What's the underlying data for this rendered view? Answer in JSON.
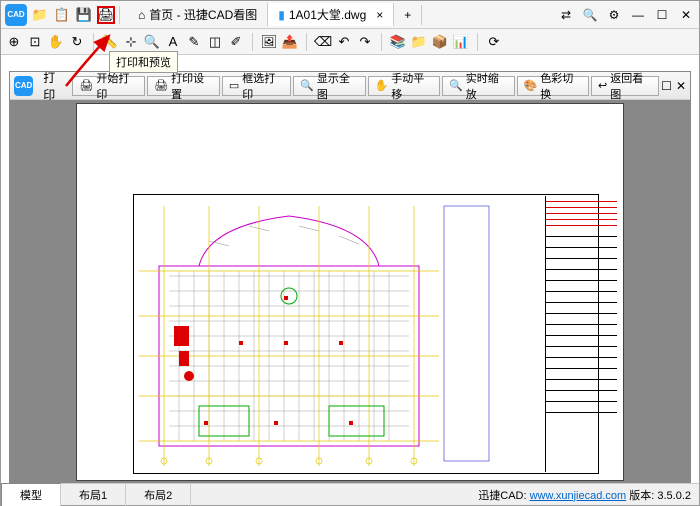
{
  "app": {
    "logo_text": "CAD"
  },
  "tabs": {
    "home": "首页 - 迅捷CAD看图",
    "file": "1A01大堂.dwg",
    "add": "+"
  },
  "tooltip": "打印和预览",
  "panel": {
    "title": "打印",
    "buttons": {
      "start_print": "开始打印",
      "print_setup": "打印设置",
      "frame_print": "框选打印",
      "show_all": "显示全图",
      "pan": "手动平移",
      "zoom": "实时缩放",
      "color": "色彩切换",
      "return": "返回看图"
    }
  },
  "bottom_tabs": {
    "model": "模型",
    "layout1": "布局1",
    "layout2": "布局2"
  },
  "status": {
    "prefix": "迅捷CAD: ",
    "link": "www.xunjiecad.com",
    "version": " 版本: 3.5.0.2"
  }
}
